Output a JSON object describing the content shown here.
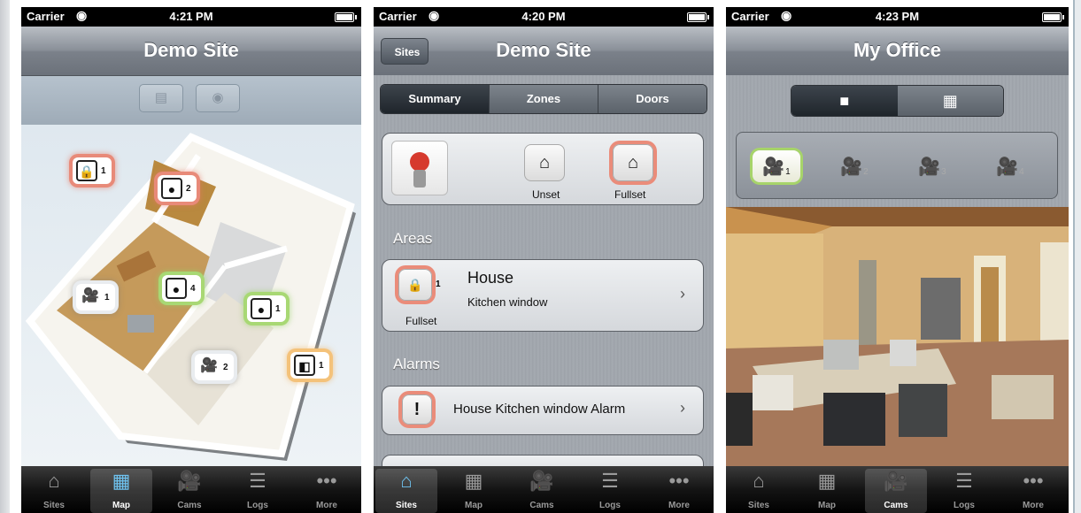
{
  "panels": [
    {
      "status": {
        "carrier": "Carrier",
        "time": "4:21 PM"
      },
      "title": "Demo Site",
      "toolbar_icons": [
        "list-icon",
        "camera-icon"
      ],
      "markers": [
        {
          "icon": "lock-icon",
          "count": "1",
          "color": "red"
        },
        {
          "icon": "door-sensor-icon",
          "count": "2",
          "color": "red"
        },
        {
          "icon": "camera-icon",
          "count": "1",
          "color": "white"
        },
        {
          "icon": "door-sensor-icon",
          "count": "4",
          "color": "green"
        },
        {
          "icon": "door-sensor-icon",
          "count": "1",
          "color": "green"
        },
        {
          "icon": "camera-icon",
          "count": "2",
          "color": "white"
        },
        {
          "icon": "door-icon",
          "count": "1",
          "color": "orange"
        }
      ],
      "active_tab": "Map"
    },
    {
      "status": {
        "carrier": "Carrier",
        "time": "4:20 PM"
      },
      "title": "Demo Site",
      "back": "Sites",
      "segments": [
        "Summary",
        "Zones",
        "Doors"
      ],
      "active_segment": "Summary",
      "summary": {
        "unset": "Unset",
        "fullset": "Fullset"
      },
      "areas_header": "Areas",
      "area": {
        "name": "House",
        "detail": "Kitchen window",
        "badge": "1",
        "state": "Fullset"
      },
      "alarms_header": "Alarms",
      "alarm": {
        "text": "House Kitchen window Alarm",
        "symbol": "!"
      },
      "active_tab": "Sites"
    },
    {
      "status": {
        "carrier": "Carrier",
        "time": "4:23 PM"
      },
      "title": "My Office",
      "view_modes": [
        "single-view-icon",
        "grid-view-icon"
      ],
      "cameras": [
        {
          "n": "1",
          "active": true
        },
        {
          "n": "2",
          "active": false
        },
        {
          "n": "3",
          "active": false
        },
        {
          "n": "4",
          "active": false
        }
      ],
      "active_tab": "Cams"
    }
  ],
  "tabs": [
    "Sites",
    "Map",
    "Cams",
    "Logs",
    "More"
  ],
  "colors": {
    "alert": "#ea8c7a",
    "ok": "#a7d46a",
    "warn": "#f4c27a",
    "tab_active": "#6fc3f0"
  }
}
